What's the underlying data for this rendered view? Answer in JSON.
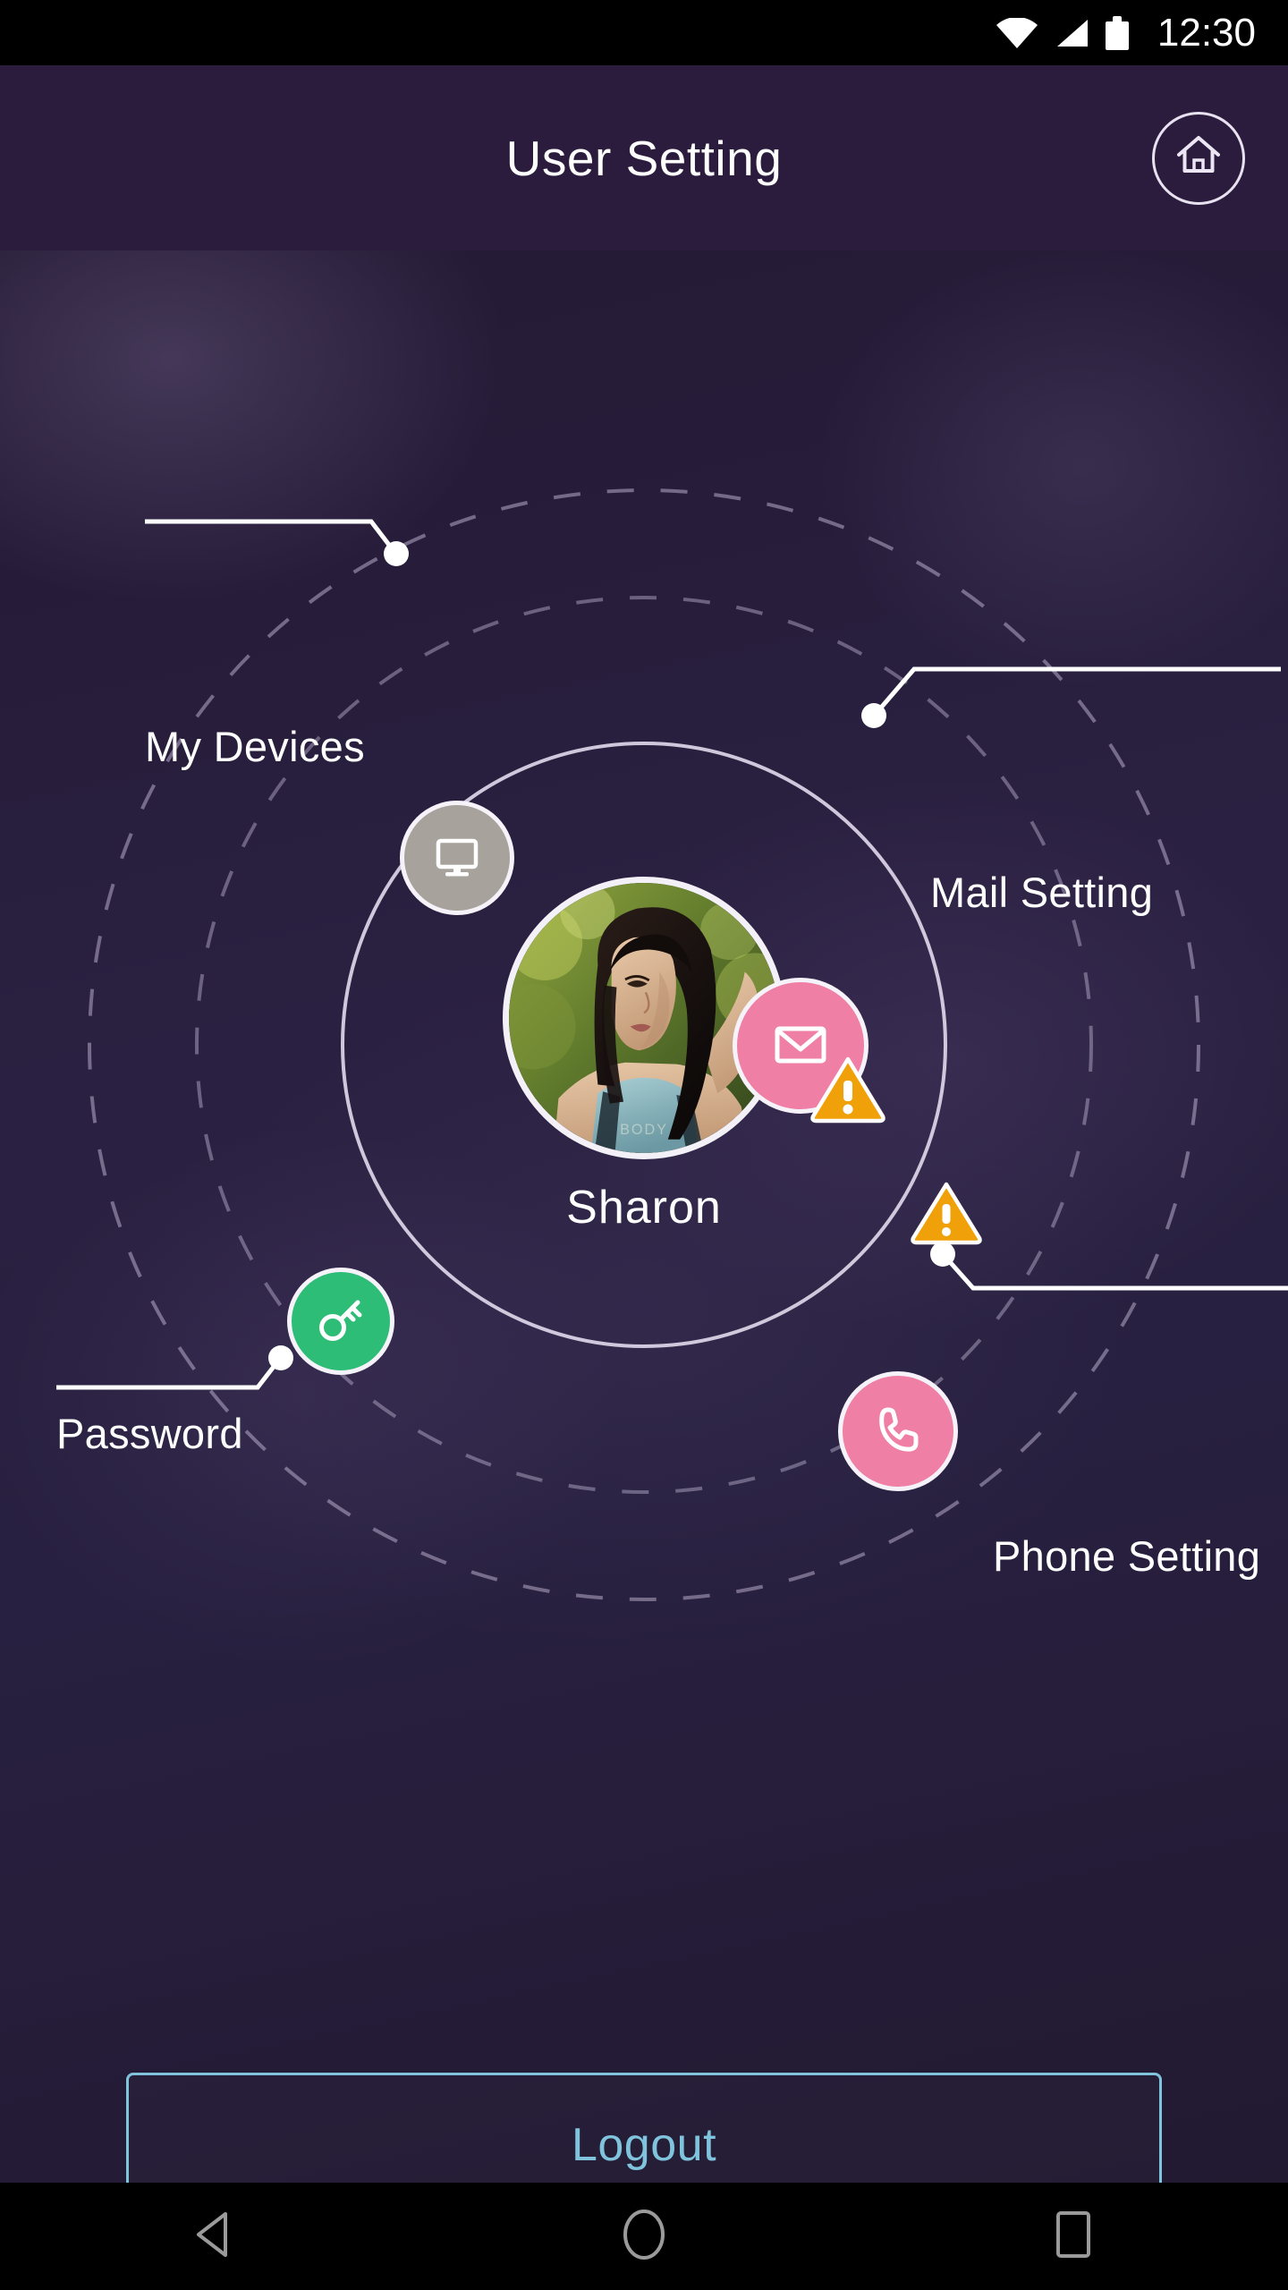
{
  "status_bar": {
    "time": "12:30",
    "icons": [
      "wifi-icon",
      "cellular-signal-icon",
      "battery-icon"
    ]
  },
  "header": {
    "title": "User Setting",
    "home_icon": "home-icon"
  },
  "profile": {
    "name": "Sharon",
    "avatar_alt": "user-avatar-photo"
  },
  "orbit_nodes": [
    {
      "id": "my-devices",
      "label": "My Devices",
      "icon": "monitor-icon",
      "color": "#a8a29c",
      "has_warning": false,
      "label_position": "top-left"
    },
    {
      "id": "mail-setting",
      "label": "Mail Setting",
      "icon": "envelope-icon",
      "color": "#ef7fa4",
      "has_warning": true,
      "warning_color": "#f0a009",
      "label_position": "top-right"
    },
    {
      "id": "password",
      "label": "Password",
      "icon": "key-icon",
      "color": "#2ebd77",
      "has_warning": false,
      "label_position": "bottom-left"
    },
    {
      "id": "phone-setting",
      "label": "Phone Setting",
      "icon": "phone-handset-icon",
      "color": "#ef7fa4",
      "has_warning": true,
      "warning_color": "#f0a009",
      "label_position": "bottom-right"
    }
  ],
  "logout": {
    "label": "Logout",
    "accent_color": "#7fc4dc"
  },
  "nav_bar": {
    "back": "back-triangle-icon",
    "home": "home-circle-icon",
    "recents": "recents-square-icon"
  },
  "theme": {
    "header_bg": "#2b1b3d",
    "canvas_bg": "#282040",
    "ring_color": "#e8e2f0",
    "status_bar_bg": "#000000"
  }
}
